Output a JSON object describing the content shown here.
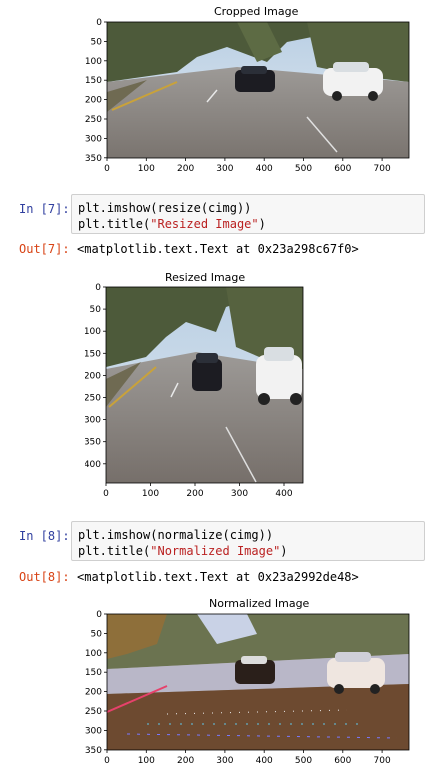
{
  "cells": {
    "cell7": {
      "in_prompt": "In [7]:",
      "code_line1": "plt.imshow(resize(cimg))",
      "code_line2_prefix": "plt.title(",
      "code_line2_string": "\"Resized Image\"",
      "code_line2_suffix": ")",
      "out_prompt": "Out[7]:",
      "output": "<matplotlib.text.Text at 0x23a298c67f0>"
    },
    "cell8": {
      "in_prompt": "In [8]:",
      "code_line1": "plt.imshow(normalize(cimg))",
      "code_line2_prefix": "plt.title(",
      "code_line2_string": "\"Normalized Image\"",
      "code_line2_suffix": ")",
      "out_prompt": "Out[8]:",
      "output": "<matplotlib.text.Text at 0x23a2992de48>"
    }
  },
  "plots": {
    "cropped": {
      "title": "Cropped Image",
      "xticks": [
        "0",
        "100",
        "200",
        "300",
        "400",
        "500",
        "600",
        "700"
      ],
      "yticks": [
        "0",
        "50",
        "100",
        "150",
        "200",
        "250",
        "300",
        "350"
      ]
    },
    "resized": {
      "title": "Resized Image",
      "xticks": [
        "0",
        "100",
        "200",
        "300",
        "400"
      ],
      "yticks": [
        "0",
        "50",
        "100",
        "150",
        "200",
        "250",
        "300",
        "350",
        "400"
      ]
    },
    "normalized": {
      "title": "Normalized Image",
      "xticks": [
        "0",
        "100",
        "200",
        "300",
        "400",
        "500",
        "600",
        "700"
      ],
      "yticks": [
        "0",
        "50",
        "100",
        "150",
        "200",
        "250",
        "300",
        "350"
      ]
    }
  },
  "colors": {
    "in_prompt": "#303f9f",
    "out_prompt": "#d84315",
    "string": "#ba2121",
    "cell_bg": "#f7f7f7"
  }
}
